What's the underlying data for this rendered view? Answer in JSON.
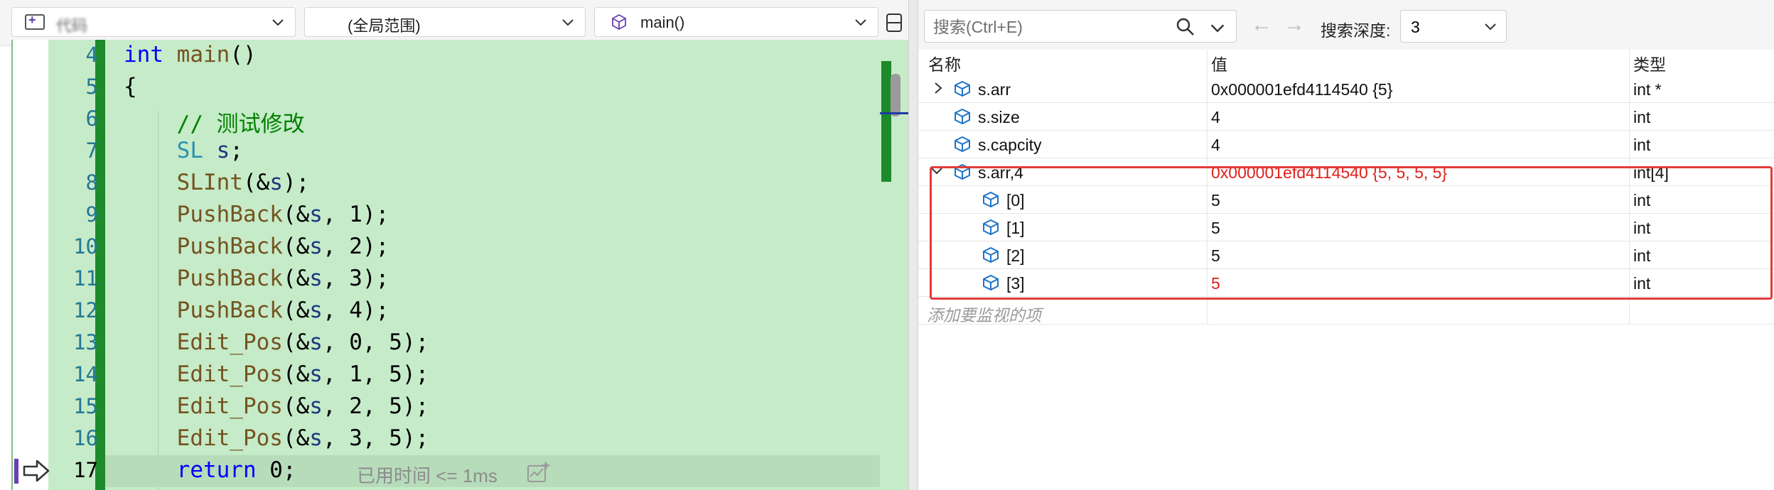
{
  "nav": {
    "project": "代码",
    "scope": "(全局范围)",
    "function": "main()"
  },
  "code_lines": [
    {
      "num": "4"
    },
    {
      "num": "5"
    },
    {
      "num": "6"
    },
    {
      "num": "7"
    },
    {
      "num": "8"
    },
    {
      "num": "9"
    },
    {
      "num": "10"
    },
    {
      "num": "11"
    },
    {
      "num": "12"
    },
    {
      "num": "13"
    },
    {
      "num": "14"
    },
    {
      "num": "15"
    },
    {
      "num": "16"
    },
    {
      "num": "17"
    }
  ],
  "code_tokens": {
    "int_kw": "int",
    "main_fn": "main",
    "parens": "()",
    "lbrace": "{",
    "comment": "// 测试修改",
    "sl_type": "SL",
    "s_var": "s",
    "semi": ";",
    "slint_fn": "SLInt",
    "pushback_fn": "PushBack",
    "editpos_fn": "Edit_Pos",
    "return_kw": "return",
    "open_amp": "(&",
    "close": ");",
    "comma_sp": ", ",
    "args_1": "1",
    "args_2": "2",
    "args_3": "3",
    "args_4": "4",
    "args_0": "0",
    "args_5": "5",
    "ret_tail": " 0;"
  },
  "elapsed_text": "已用时间 <= 1ms",
  "watch": {
    "search_placeholder": "搜索(Ctrl+E)",
    "depth_label": "搜索深度:",
    "depth_value": "3",
    "columns": {
      "name": "名称",
      "value": "值",
      "type": "类型"
    },
    "rows": [
      {
        "name": "s.arr",
        "value": "0x000001efd4114540 {5}",
        "type": "int *"
      },
      {
        "name": "s.size",
        "value": "4",
        "type": "int"
      },
      {
        "name": "s.capcity",
        "value": "4",
        "type": "int"
      },
      {
        "name": "s.arr,4",
        "value": "0x000001efd4114540 {5, 5, 5, 5}",
        "type": "int[4]"
      },
      {
        "name": "[0]",
        "value": "5",
        "type": "int"
      },
      {
        "name": "[1]",
        "value": "5",
        "type": "int"
      },
      {
        "name": "[2]",
        "value": "5",
        "type": "int"
      },
      {
        "name": "[3]",
        "value": "5",
        "type": "int"
      }
    ],
    "add_watch": "添加要监视的项"
  },
  "colors": {
    "code_bg": "#c6ebc9",
    "change_bar": "#1d8a2b",
    "changed_value": "#e0201b",
    "highlight_box": "#e33b3b"
  }
}
